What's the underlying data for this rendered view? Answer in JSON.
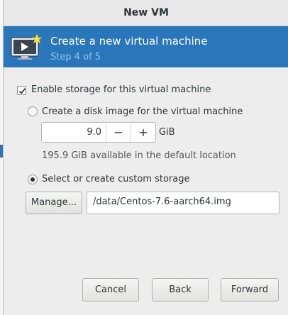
{
  "window": {
    "title": "New VM"
  },
  "banner": {
    "title": "Create a new virtual machine",
    "step": "Step 4 of 5",
    "icon": "virtual-machine-screen-icon",
    "bg_color": "#2a76bb"
  },
  "storage": {
    "enable_label": "Enable storage for this virtual machine",
    "enable_checked": true,
    "disk_image_label": "Create a disk image for the virtual machine",
    "disk_image_selected": false,
    "size_value": "9.0",
    "decrement_label": "−",
    "increment_label": "+",
    "size_unit": "GiB",
    "available_text": "195.9 GiB available in the default location",
    "custom_label": "Select or create custom storage",
    "custom_selected": true,
    "manage_label": "Manage...",
    "path_value": "/data/Centos-7.6-aarch64.img"
  },
  "buttons": {
    "cancel": "Cancel",
    "back": "Back",
    "forward": "Forward"
  }
}
